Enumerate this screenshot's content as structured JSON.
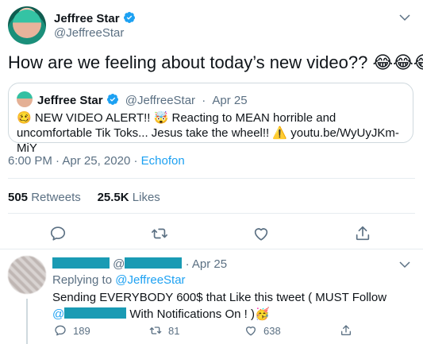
{
  "colors": {
    "accent": "#1da1f2",
    "text": "#0f1419",
    "muted": "#5b7083",
    "redaction": "#1a9bb4"
  },
  "tweet": {
    "author_name": "Jeffree Star",
    "author_handle": "@JeffreeStar",
    "text": "How are we feeling about today’s new video??",
    "emoji": "😂😂😂",
    "quote": {
      "author_name": "Jeffree Star",
      "author_handle": "@JeffreeStar",
      "separator": "·",
      "date": "Apr 25",
      "body_emoji_1": "🥴",
      "body_part1": " NEW VIDEO ALERT!! ",
      "body_emoji_2": "🤯",
      "body_part2": " Reacting to MEAN horrible and uncomfortable Tik Toks... Jesus take the wheel!! ",
      "body_emoji_3": "⚠️",
      "link": "youtu.be/WyUyJKm-MiY"
    },
    "time": "6:00 PM",
    "date": "Apr 25, 2020",
    "separator": "·",
    "source": "Echofon",
    "retweets_count": "505",
    "retweets_label": "Retweets",
    "likes_count": "25.5K",
    "likes_label": "Likes",
    "action_icons": [
      "reply-icon",
      "retweet-icon",
      "like-icon",
      "share-icon"
    ]
  },
  "reply": {
    "at": "@",
    "separator": "·",
    "date": "Apr 25",
    "replying_to_label": "Replying to",
    "replying_to_handle": "@JeffreeStar",
    "body_line1": "Sending EVERYBODY 600$ that Like this tweet ( MUST Follow",
    "mention_at": "@",
    "body_line2": " With Notifications On ! )",
    "body_emoji": "🥳",
    "reply_count": "189",
    "retweet_count": "81",
    "like_count": "638"
  }
}
